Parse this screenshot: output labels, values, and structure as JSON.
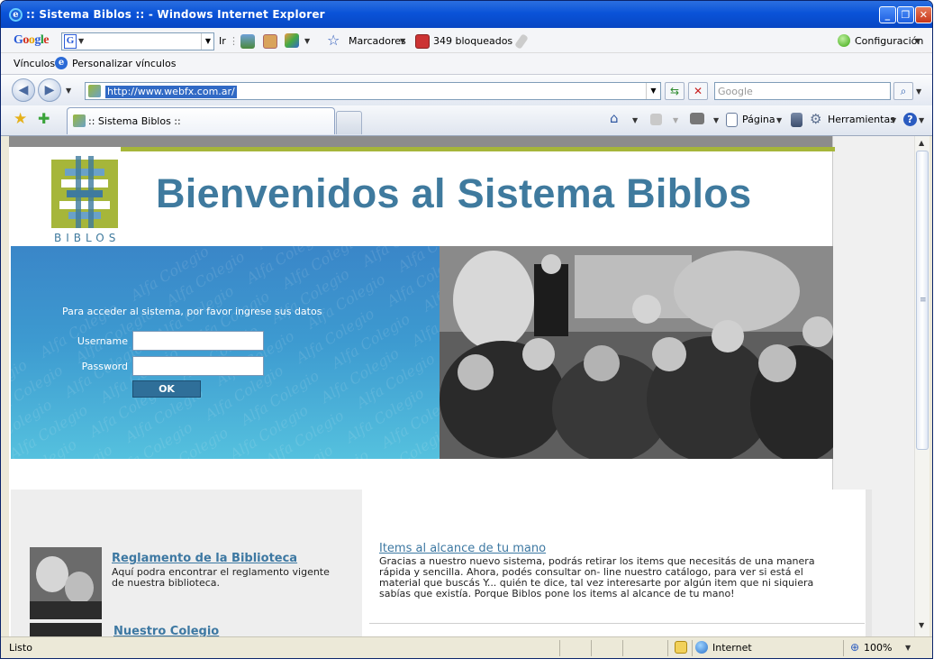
{
  "window": {
    "title": ":: Sistema Biblos :: - Windows Internet Explorer",
    "controls": [
      "minimize",
      "maximize",
      "close"
    ]
  },
  "google_toolbar": {
    "logo": "Google",
    "search_value": "",
    "go_label": "Ir",
    "bookmarks_label": "Marcadores",
    "blocked_label": "349 bloqueados",
    "settings_label": "Configuración"
  },
  "links_bar": {
    "label": "Vínculos",
    "item": "Personalizar vínculos"
  },
  "address_bar": {
    "url": "http://www.webfx.com.ar/",
    "search_placeholder": "Google"
  },
  "tabs": [
    {
      "label": ":: Sistema Biblos ::",
      "active": true
    }
  ],
  "command_bar": {
    "page_label": "Página",
    "tools_label": "Herramientas"
  },
  "page": {
    "logo_text": "BIBLOS",
    "headline": "Bienvenidos al Sistema Biblos",
    "login": {
      "message": "Para acceder al sistema, por favor ingrese sus datos",
      "username_label": "Username",
      "password_label": "Password",
      "username_value": "",
      "password_value": "",
      "submit_label": "OK"
    },
    "watermark_text": "Alfa Colegio",
    "left_section": {
      "items": [
        {
          "title": "Reglamento de la Biblioteca",
          "description": "Aquí podra encontrar el reglamento vigente de nuestra biblioteca."
        },
        {
          "title": "Nuestro Colegio",
          "description": ""
        }
      ]
    },
    "right_section": {
      "title": "Items al alcance de tu mano",
      "body": "Gracias a nuestro nuevo sistema, podrás retirar los items que necesitás de una manera rápida y sencilla. Ahora, podés consultar on- line nuestro catálogo, para ver si está el material que buscás Y... quién te dice, tal vez interesarte por algún item que ni siquiera sabías que existía. Porque Biblos pone los items al alcance de tu mano!"
    }
  },
  "status_bar": {
    "status": "Listo",
    "zone": "Internet",
    "zoom": "100%"
  },
  "colors": {
    "title_blue": "#0a53d8",
    "headline": "#3f7a9e",
    "accent_green": "#a6b63a",
    "login_gradient_top": "#3a86c8",
    "login_gradient_bottom": "#55c1de",
    "link": "#3d78a2"
  }
}
